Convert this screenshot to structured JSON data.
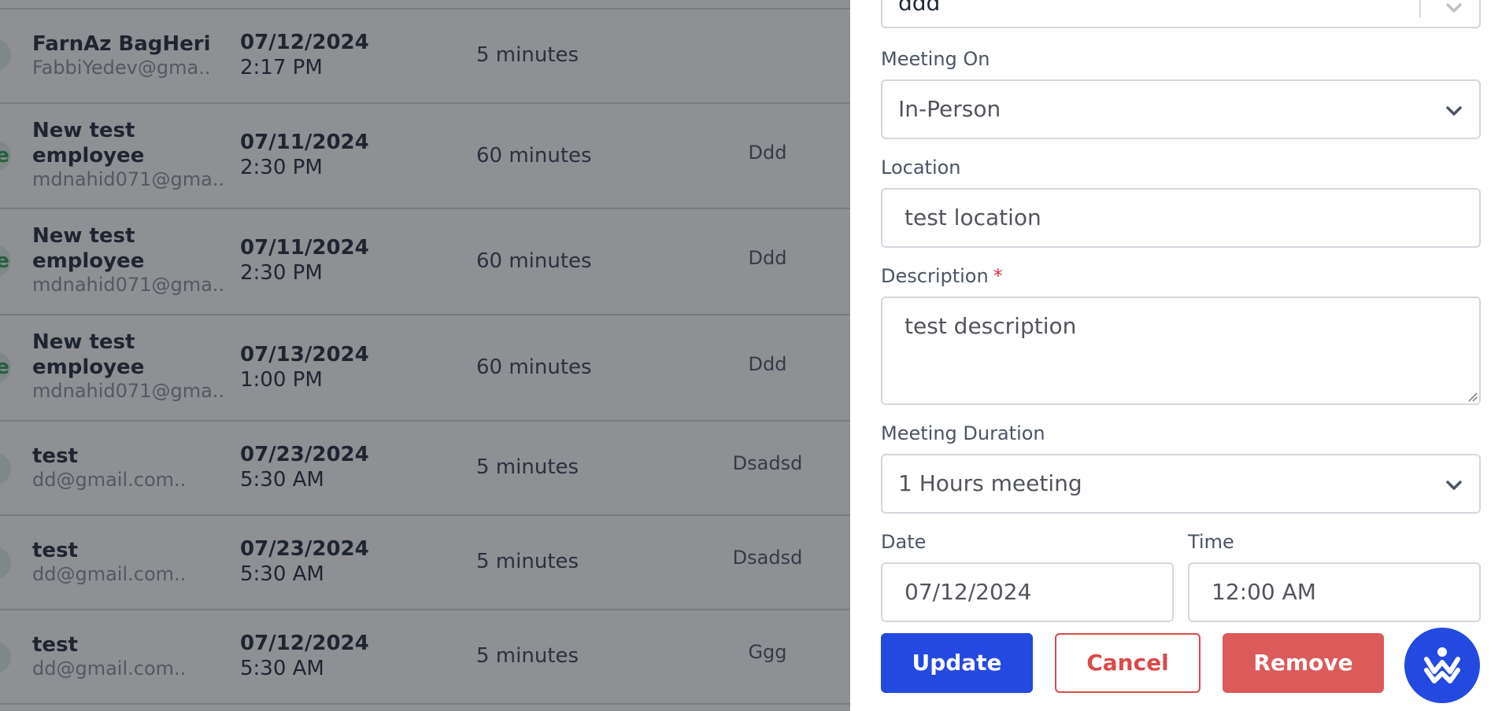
{
  "rows": [
    {
      "avatar_letter": "",
      "name": "FarnAz BagHeri",
      "email": "FabbiYedev@gma..",
      "date": "07/12/2024",
      "time": "2:17 PM",
      "duration": "5 minutes",
      "description": ""
    },
    {
      "avatar_letter": "e",
      "name": "New test employee",
      "email": "mdnahid071@gma..",
      "date": "07/11/2024",
      "time": "2:30 PM",
      "duration": "60 minutes",
      "description": "Ddd"
    },
    {
      "avatar_letter": "e",
      "name": "New test employee",
      "email": "mdnahid071@gma..",
      "date": "07/11/2024",
      "time": "2:30 PM",
      "duration": "60 minutes",
      "description": "Ddd"
    },
    {
      "avatar_letter": "e",
      "name": "New test employee",
      "email": "mdnahid071@gma..",
      "date": "07/13/2024",
      "time": "1:00 PM",
      "duration": "60 minutes",
      "description": "Ddd"
    },
    {
      "avatar_letter": "",
      "name": "test",
      "email": "dd@gmail.com..",
      "date": "07/23/2024",
      "time": "5:30 AM",
      "duration": "5 minutes",
      "description": "Dsadsd"
    },
    {
      "avatar_letter": "",
      "name": "test",
      "email": "dd@gmail.com..",
      "date": "07/23/2024",
      "time": "5:30 AM",
      "duration": "5 minutes",
      "description": "Dsadsd"
    },
    {
      "avatar_letter": "",
      "name": "test",
      "email": "dd@gmail.com..",
      "date": "07/12/2024",
      "time": "5:30 AM",
      "duration": "5 minutes",
      "description": "Ggg"
    }
  ],
  "form": {
    "top_select_value": "ddd",
    "meeting_on": {
      "label": "Meeting On",
      "value": "In-Person"
    },
    "location": {
      "label": "Location",
      "value": "test location"
    },
    "description": {
      "label": "Description",
      "required_mark": "*",
      "value": "test description"
    },
    "meeting_duration": {
      "label": "Meeting Duration",
      "value": "1 Hours meeting"
    },
    "date": {
      "label": "Date",
      "value": "07/12/2024"
    },
    "time": {
      "label": "Time",
      "value": "12:00 AM"
    }
  },
  "buttons": {
    "update": "Update",
    "cancel": "Cancel",
    "remove": "Remove"
  },
  "colors": {
    "primary": "#2449e0",
    "danger": "#dc5a5a",
    "overlay": "#1e212a"
  }
}
